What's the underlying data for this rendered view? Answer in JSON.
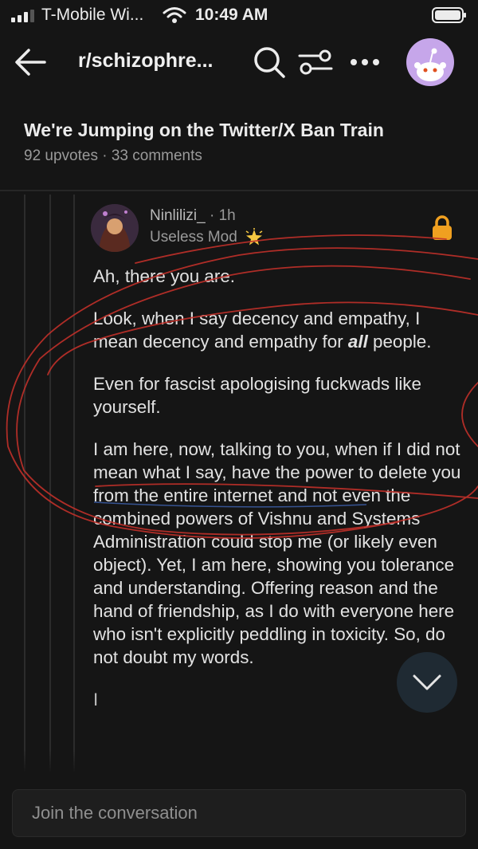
{
  "status_bar": {
    "carrier": "T-Mobile Wi...",
    "time": "10:49 AM"
  },
  "header": {
    "subreddit": "r/schizophre...",
    "icons": [
      "back-arrow-icon",
      "search-icon",
      "filter-icon",
      "more-icon",
      "user-avatar"
    ]
  },
  "post": {
    "title": "We're Jumping on the Twitter/X Ban Train",
    "upvotes": "92 upvotes",
    "separator": "·",
    "comments": "33 comments"
  },
  "comment": {
    "author": "Ninlilizi_",
    "age": "· 1h",
    "flair": "Useless Mod",
    "lock_color": "#f0a020",
    "paragraphs": {
      "p1": "Ah, there you are.",
      "p2_before": "Look, when I say decency and empathy, I mean decency and empathy for ",
      "p2_em": "all",
      "p2_after": " people.",
      "p3": "Even for fascist apologising fuckwads like yourself.",
      "p4": "I am here, now, talking to you, when if I did not mean what I say, have the power to delete you from the entire internet and not even the combined powers of Vishnu and Systems Administration could stop me (or likely even object). Yet, I am here, showing you tolerance and understanding. Offering reason and the hand of friendship, as I do with everyone here who isn't explicitly peddling in toxicity. So, do not doubt my words.",
      "p5_partial": "I"
    }
  },
  "bottom": {
    "placeholder": "Join the conversation"
  },
  "colors": {
    "background": "#151515",
    "annotation_red": "#c0302a",
    "avatar_bg": "#c6a6ea"
  }
}
